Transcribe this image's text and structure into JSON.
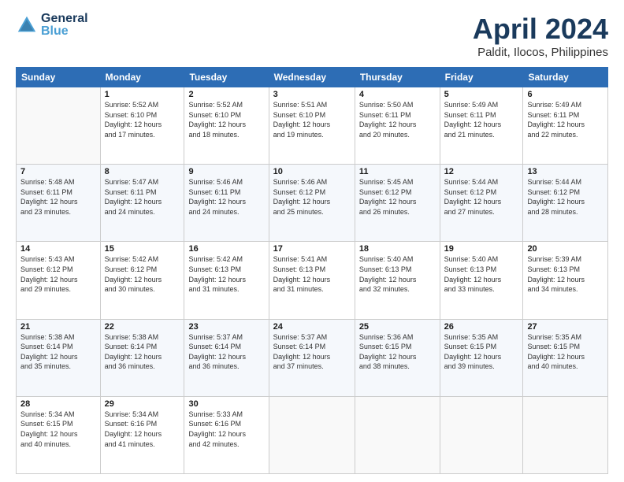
{
  "header": {
    "logo_general": "General",
    "logo_blue": "Blue",
    "title": "April 2024",
    "subtitle": "Paldit, Ilocos, Philippines"
  },
  "calendar": {
    "headers": [
      "Sunday",
      "Monday",
      "Tuesday",
      "Wednesday",
      "Thursday",
      "Friday",
      "Saturday"
    ],
    "rows": [
      [
        {
          "num": "",
          "info": ""
        },
        {
          "num": "1",
          "info": "Sunrise: 5:52 AM\nSunset: 6:10 PM\nDaylight: 12 hours\nand 17 minutes."
        },
        {
          "num": "2",
          "info": "Sunrise: 5:52 AM\nSunset: 6:10 PM\nDaylight: 12 hours\nand 18 minutes."
        },
        {
          "num": "3",
          "info": "Sunrise: 5:51 AM\nSunset: 6:10 PM\nDaylight: 12 hours\nand 19 minutes."
        },
        {
          "num": "4",
          "info": "Sunrise: 5:50 AM\nSunset: 6:11 PM\nDaylight: 12 hours\nand 20 minutes."
        },
        {
          "num": "5",
          "info": "Sunrise: 5:49 AM\nSunset: 6:11 PM\nDaylight: 12 hours\nand 21 minutes."
        },
        {
          "num": "6",
          "info": "Sunrise: 5:49 AM\nSunset: 6:11 PM\nDaylight: 12 hours\nand 22 minutes."
        }
      ],
      [
        {
          "num": "7",
          "info": "Sunrise: 5:48 AM\nSunset: 6:11 PM\nDaylight: 12 hours\nand 23 minutes."
        },
        {
          "num": "8",
          "info": "Sunrise: 5:47 AM\nSunset: 6:11 PM\nDaylight: 12 hours\nand 24 minutes."
        },
        {
          "num": "9",
          "info": "Sunrise: 5:46 AM\nSunset: 6:11 PM\nDaylight: 12 hours\nand 24 minutes."
        },
        {
          "num": "10",
          "info": "Sunrise: 5:46 AM\nSunset: 6:12 PM\nDaylight: 12 hours\nand 25 minutes."
        },
        {
          "num": "11",
          "info": "Sunrise: 5:45 AM\nSunset: 6:12 PM\nDaylight: 12 hours\nand 26 minutes."
        },
        {
          "num": "12",
          "info": "Sunrise: 5:44 AM\nSunset: 6:12 PM\nDaylight: 12 hours\nand 27 minutes."
        },
        {
          "num": "13",
          "info": "Sunrise: 5:44 AM\nSunset: 6:12 PM\nDaylight: 12 hours\nand 28 minutes."
        }
      ],
      [
        {
          "num": "14",
          "info": "Sunrise: 5:43 AM\nSunset: 6:12 PM\nDaylight: 12 hours\nand 29 minutes."
        },
        {
          "num": "15",
          "info": "Sunrise: 5:42 AM\nSunset: 6:12 PM\nDaylight: 12 hours\nand 30 minutes."
        },
        {
          "num": "16",
          "info": "Sunrise: 5:42 AM\nSunset: 6:13 PM\nDaylight: 12 hours\nand 31 minutes."
        },
        {
          "num": "17",
          "info": "Sunrise: 5:41 AM\nSunset: 6:13 PM\nDaylight: 12 hours\nand 31 minutes."
        },
        {
          "num": "18",
          "info": "Sunrise: 5:40 AM\nSunset: 6:13 PM\nDaylight: 12 hours\nand 32 minutes."
        },
        {
          "num": "19",
          "info": "Sunrise: 5:40 AM\nSunset: 6:13 PM\nDaylight: 12 hours\nand 33 minutes."
        },
        {
          "num": "20",
          "info": "Sunrise: 5:39 AM\nSunset: 6:13 PM\nDaylight: 12 hours\nand 34 minutes."
        }
      ],
      [
        {
          "num": "21",
          "info": "Sunrise: 5:38 AM\nSunset: 6:14 PM\nDaylight: 12 hours\nand 35 minutes."
        },
        {
          "num": "22",
          "info": "Sunrise: 5:38 AM\nSunset: 6:14 PM\nDaylight: 12 hours\nand 36 minutes."
        },
        {
          "num": "23",
          "info": "Sunrise: 5:37 AM\nSunset: 6:14 PM\nDaylight: 12 hours\nand 36 minutes."
        },
        {
          "num": "24",
          "info": "Sunrise: 5:37 AM\nSunset: 6:14 PM\nDaylight: 12 hours\nand 37 minutes."
        },
        {
          "num": "25",
          "info": "Sunrise: 5:36 AM\nSunset: 6:15 PM\nDaylight: 12 hours\nand 38 minutes."
        },
        {
          "num": "26",
          "info": "Sunrise: 5:35 AM\nSunset: 6:15 PM\nDaylight: 12 hours\nand 39 minutes."
        },
        {
          "num": "27",
          "info": "Sunrise: 5:35 AM\nSunset: 6:15 PM\nDaylight: 12 hours\nand 40 minutes."
        }
      ],
      [
        {
          "num": "28",
          "info": "Sunrise: 5:34 AM\nSunset: 6:15 PM\nDaylight: 12 hours\nand 40 minutes."
        },
        {
          "num": "29",
          "info": "Sunrise: 5:34 AM\nSunset: 6:16 PM\nDaylight: 12 hours\nand 41 minutes."
        },
        {
          "num": "30",
          "info": "Sunrise: 5:33 AM\nSunset: 6:16 PM\nDaylight: 12 hours\nand 42 minutes."
        },
        {
          "num": "",
          "info": ""
        },
        {
          "num": "",
          "info": ""
        },
        {
          "num": "",
          "info": ""
        },
        {
          "num": "",
          "info": ""
        }
      ]
    ]
  }
}
